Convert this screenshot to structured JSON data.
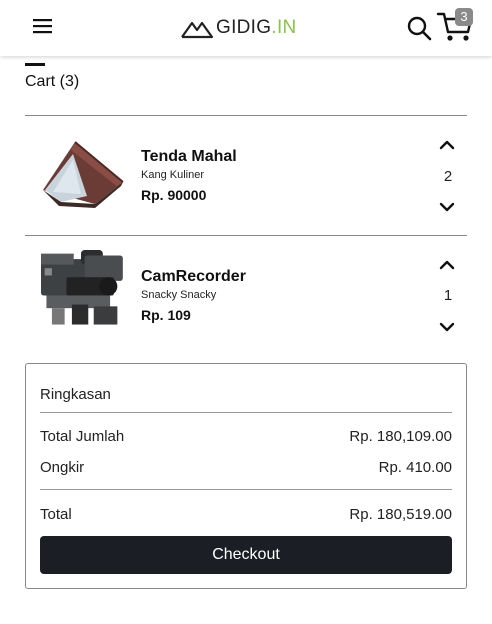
{
  "header": {
    "logo_text_main": "GIDIG",
    "logo_text_dot": ".",
    "logo_text_suffix": "IN",
    "cart_count": "3",
    "accent_color": "#8bc34a"
  },
  "cart": {
    "heading": "Cart (3)",
    "items": [
      {
        "name": "Tenda Mahal",
        "seller": "Kang Kuliner",
        "price": "Rp. 90000",
        "quantity": "2"
      },
      {
        "name": "CamRecorder",
        "seller": "Snacky Snacky",
        "price": "Rp. 109",
        "quantity": "1"
      }
    ]
  },
  "summary": {
    "title": "Ringkasan",
    "subtotal_label": "Total Jumlah",
    "subtotal_value": "Rp. 180,109.00",
    "shipping_label": "Ongkir",
    "shipping_value": "Rp. 410.00",
    "total_label": "Total",
    "total_value": "Rp. 180,519.00",
    "checkout_label": "Checkout"
  },
  "icons": [
    "hamburger-menu-icon",
    "search-icon",
    "cart-icon",
    "chevron-up-icon",
    "chevron-down-icon"
  ]
}
